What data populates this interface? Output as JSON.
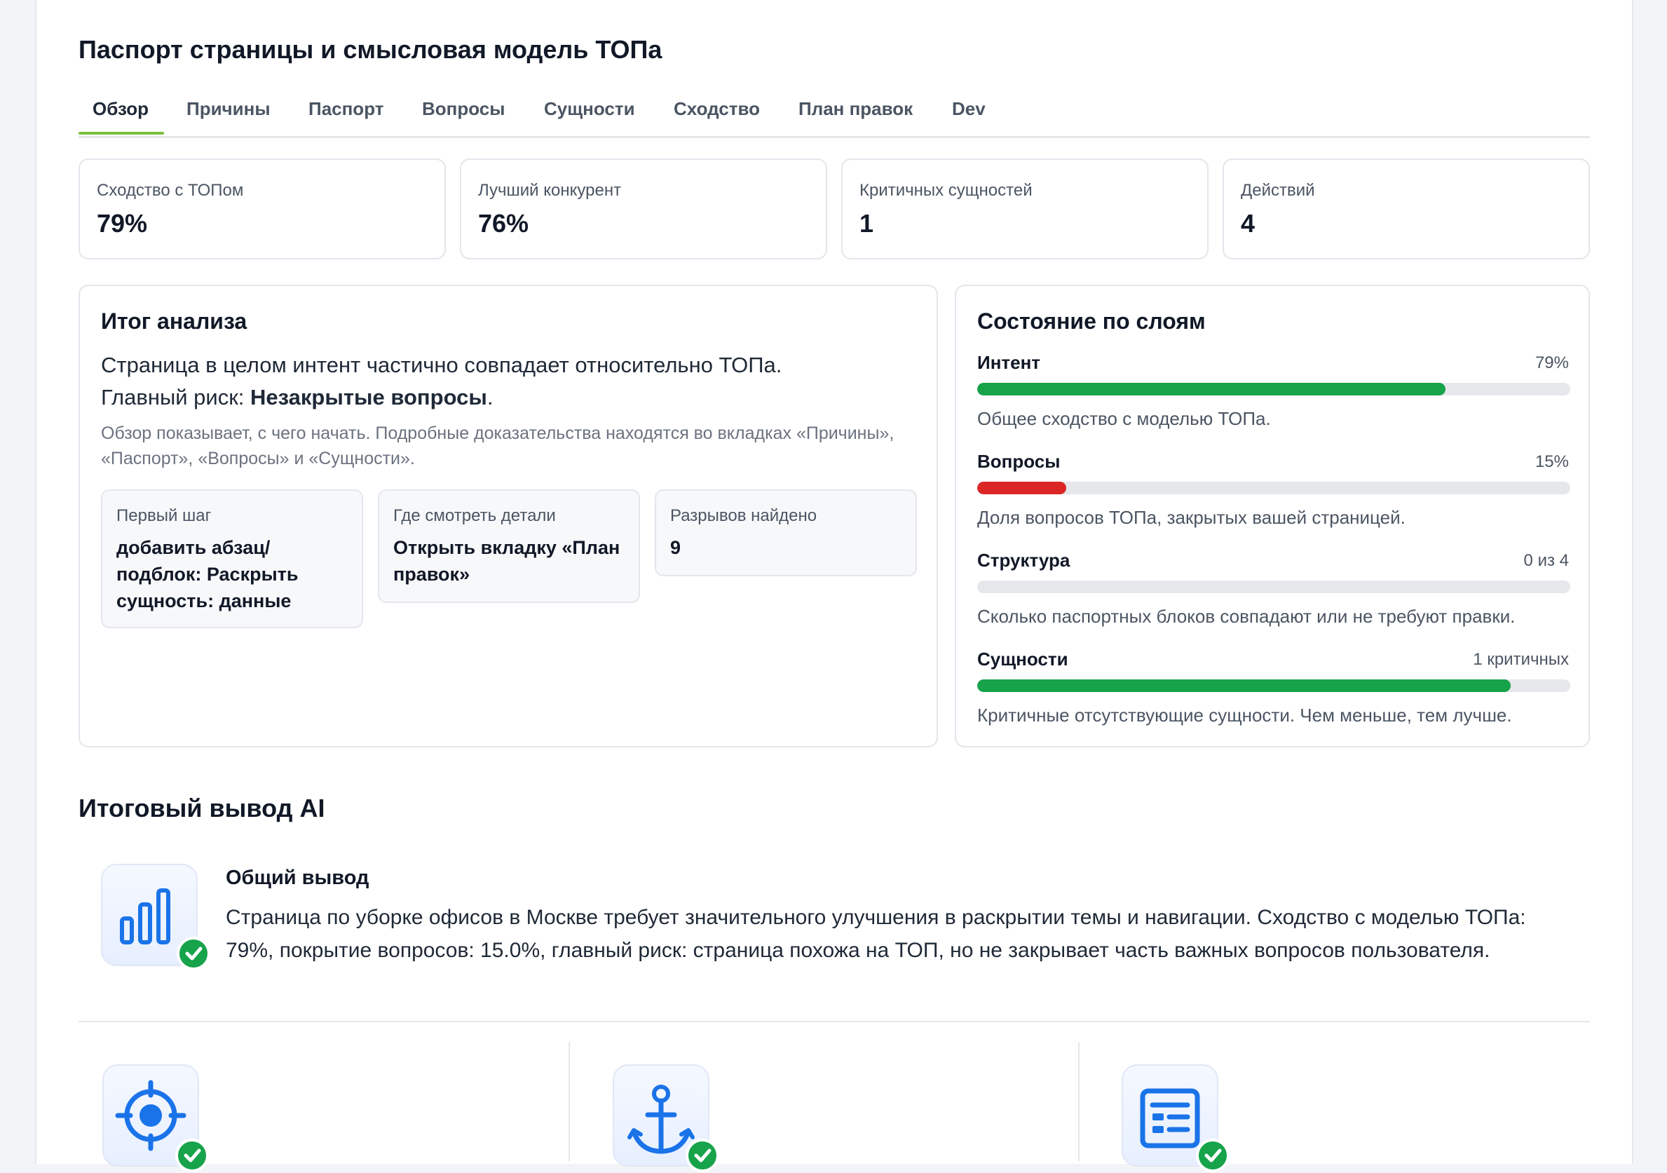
{
  "page_title": "Паспорт страницы и смысловая модель ТОПа",
  "tabs": [
    {
      "label": "Обзор"
    },
    {
      "label": "Причины"
    },
    {
      "label": "Паспорт"
    },
    {
      "label": "Вопросы"
    },
    {
      "label": "Сущности"
    },
    {
      "label": "Сходство"
    },
    {
      "label": "План правок"
    },
    {
      "label": "Dev"
    }
  ],
  "stats": [
    {
      "label": "Сходство с ТОПом",
      "value": "79%"
    },
    {
      "label": "Лучший конкурент",
      "value": "76%"
    },
    {
      "label": "Критичных сущностей",
      "value": "1"
    },
    {
      "label": "Действий",
      "value": "4"
    }
  ],
  "summary": {
    "title": "Итог анализа",
    "line1": "Страница в целом интент частично совпадает относительно ТОПа.",
    "line2_prefix": "Главный риск: ",
    "line2_bold": "Незакрытые вопросы",
    "line2_suffix": ".",
    "note": "Обзор показывает, с чего начать. Подробные доказательства находятся во вкладках «Причины», «Паспорт», «Вопросы» и «Сущности».",
    "cards": [
      {
        "label": "Первый шаг",
        "value": "добавить абзац/подблок: Раскрыть сущность: данные"
      },
      {
        "label": "Где смотреть детали",
        "value": "Открыть вкладку «План правок»"
      },
      {
        "label": "Разрывов найдено",
        "value": "9"
      }
    ]
  },
  "layers": {
    "title": "Состояние по слоям",
    "items": [
      {
        "name": "Интент",
        "value": "79%",
        "fill": 0.79,
        "color": "#16a34a",
        "desc": "Общее сходство с моделью ТОПа."
      },
      {
        "name": "Вопросы",
        "value": "15%",
        "fill": 0.15,
        "color": "#dc2626",
        "desc": "Доля вопросов ТОПа, закрытых вашей страницей."
      },
      {
        "name": "Структура",
        "value": "0 из 4",
        "fill": 0.0,
        "color": "#16a34a",
        "desc": "Сколько паспортных блоков совпадают или не требуют правки."
      },
      {
        "name": "Сущности",
        "value": "1 критичных",
        "fill": 0.9,
        "color": "#16a34a",
        "desc": "Критичные отсутствующие сущности. Чем меньше, тем лучше."
      }
    ]
  },
  "ai": {
    "title": "Итоговый вывод AI",
    "general_title": "Общий вывод",
    "general_text": "Страница по уборке офисов в Москве требует значительного улучшения в раскрытии темы и навигации. Сходство с моделью ТОПа: 79%, покрытие вопросов: 15.0%, главный риск: страница похожа на ТОП, но не закрывает часть важных вопросов пользователя.",
    "icons": [
      "bar-chart-icon",
      "target-icon",
      "anchor-icon",
      "document-list-icon"
    ]
  },
  "colors": {
    "accent": "#7cbf3e",
    "good": "#16a34a",
    "bad": "#dc2626",
    "icon": "#1a73e8"
  }
}
